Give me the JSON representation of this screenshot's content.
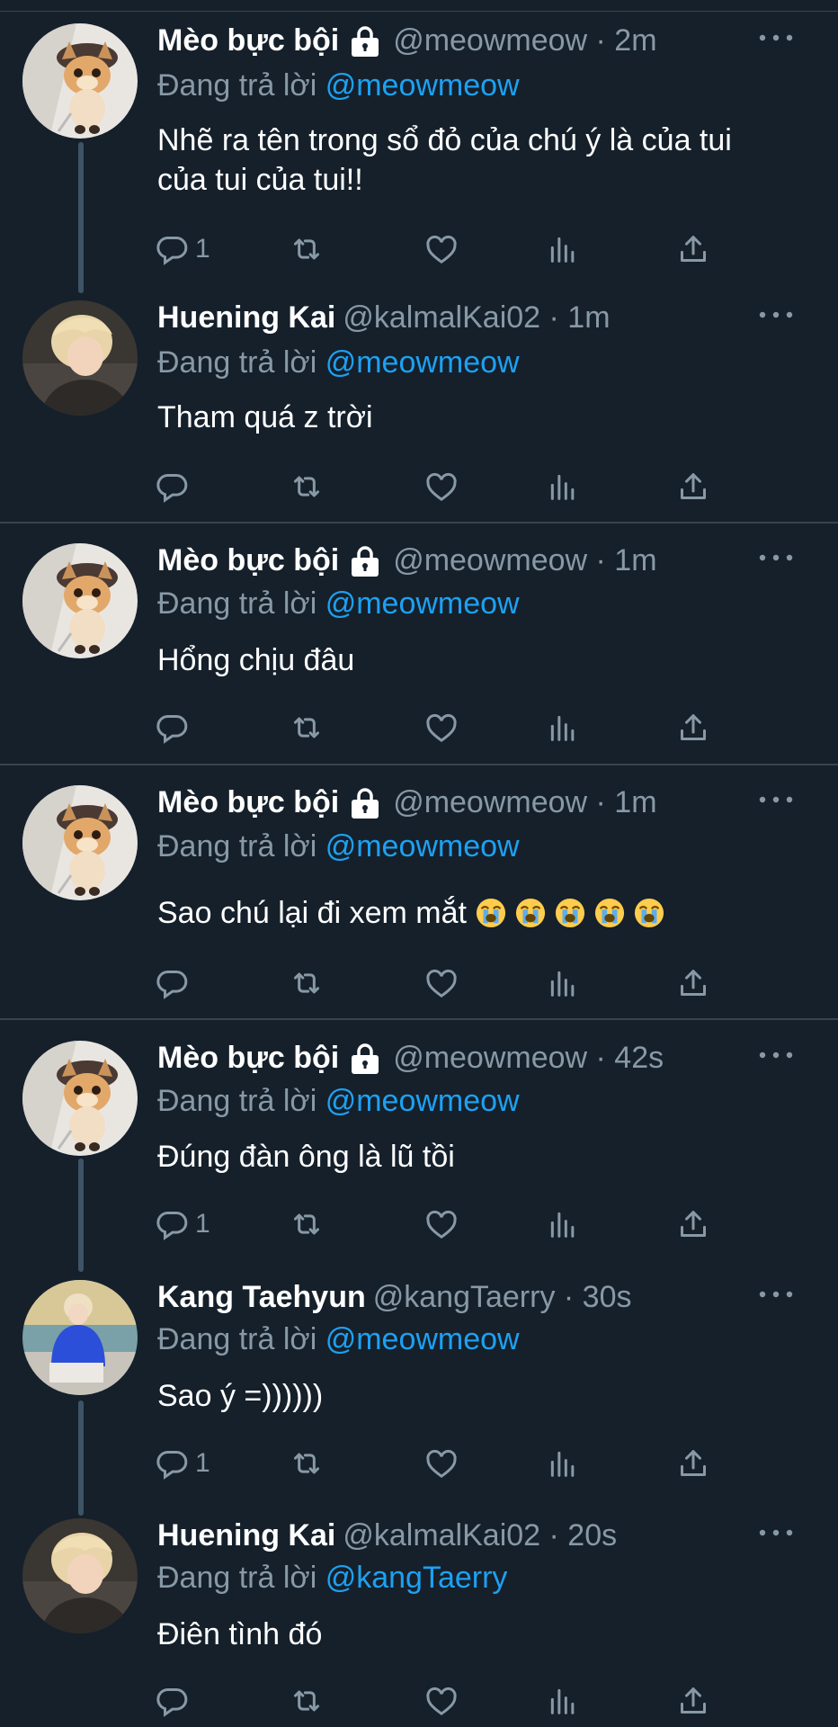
{
  "reply_prefix": "Đang trả lời",
  "tweets": [
    {
      "name": "Mèo bực bội",
      "locked": true,
      "handle": "@meowmeow",
      "time": "2m",
      "reply_to": "@meowmeow",
      "text": "Nhẽ ra tên trong sổ đỏ của chú ý là của tui của tui của tui!!",
      "replies": "1",
      "avatar": "cat-avatar"
    },
    {
      "name": "Huening Kai",
      "locked": false,
      "handle": "@kalmalKai02",
      "time": "1m",
      "reply_to": "@meowmeow",
      "text": "Tham quá z trời",
      "replies": "",
      "avatar": "blond-person-avatar"
    },
    {
      "name": "Mèo bực bội",
      "locked": true,
      "handle": "@meowmeow",
      "time": "1m",
      "reply_to": "@meowmeow",
      "text": "Hổng chịu đâu",
      "replies": "",
      "avatar": "cat-avatar"
    },
    {
      "name": "Mèo bực bội",
      "locked": true,
      "handle": "@meowmeow",
      "time": "1m",
      "reply_to": "@meowmeow",
      "text": "Sao chú lại đi xem mắt",
      "emoji": [
        "loudly-crying-face",
        "loudly-crying-face",
        "loudly-crying-face",
        "loudly-crying-face",
        "loudly-crying-face"
      ],
      "replies": "",
      "avatar": "cat-avatar"
    },
    {
      "name": "Mèo bực bội",
      "locked": true,
      "handle": "@meowmeow",
      "time": "42s",
      "reply_to": "@meowmeow",
      "text": "Đúng đàn ông là lũ tồi",
      "replies": "1",
      "avatar": "cat-avatar"
    },
    {
      "name": "Kang Taehyun",
      "locked": false,
      "handle": "@kangTaerry",
      "time": "30s",
      "reply_to": "@meowmeow",
      "text": "Sao ý =))))))",
      "replies": "1",
      "avatar": "blue-sweater-person-avatar"
    },
    {
      "name": "Huening Kai",
      "locked": false,
      "handle": "@kalmalKai02",
      "time": "20s",
      "reply_to": "@kangTaerry",
      "text": "Điên tình đó",
      "replies": "",
      "avatar": "blond-person-avatar"
    }
  ],
  "colors": {
    "background": "#15202b",
    "divider": "#38444d",
    "secondary_text": "#8899a6",
    "mention": "#1da1f2"
  },
  "icons": [
    "reply-icon",
    "retweet-icon",
    "like-icon",
    "analytics-icon",
    "share-icon",
    "lock-icon",
    "more-icon"
  ]
}
